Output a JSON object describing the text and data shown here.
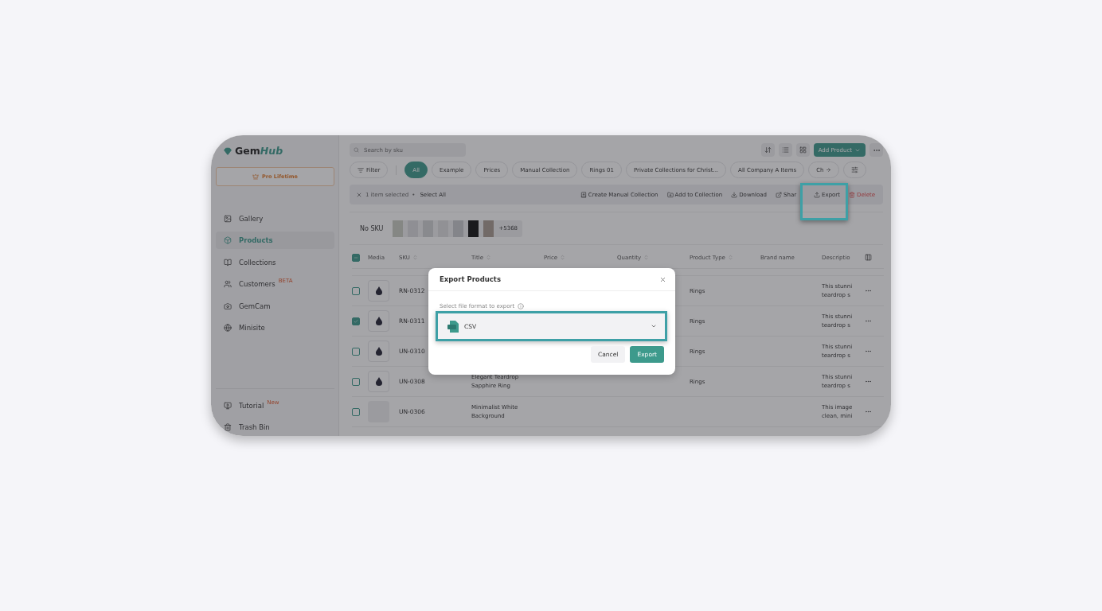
{
  "logo": {
    "text_a": "Gem",
    "text_b": "Hub"
  },
  "plan_badge": "Pro Lifetime",
  "sidebar": {
    "items": [
      {
        "label": "Gallery",
        "selected": false
      },
      {
        "label": "Products",
        "selected": true
      },
      {
        "label": "Collections",
        "selected": false
      },
      {
        "label": "Customers",
        "selected": false,
        "badge": "BETA"
      },
      {
        "label": "GemCam",
        "selected": false
      },
      {
        "label": "Minisite",
        "selected": false
      }
    ],
    "bottom_items": [
      {
        "label": "Tutorial",
        "badge": "New"
      },
      {
        "label": "Trash Bin"
      }
    ]
  },
  "search": {
    "placeholder": "Search by sku"
  },
  "add_product_button": "Add Product",
  "filter_button": "Filter",
  "chips": [
    {
      "label": "All",
      "selected": true
    },
    {
      "label": "Example",
      "selected": false
    },
    {
      "label": "Prices",
      "selected": false
    },
    {
      "label": "Manual Collection",
      "selected": false
    },
    {
      "label": "Rings 01",
      "selected": false
    },
    {
      "label": "Private Collections for Christ...",
      "selected": false
    },
    {
      "label": "All Company A Items",
      "selected": false
    },
    {
      "label": "Ch",
      "selected": false
    }
  ],
  "selection_bar": {
    "count_text": "1 item selected",
    "separator": "•",
    "select_all": "Select All",
    "actions": [
      {
        "label": "Create Manual Collection",
        "kind": "normal"
      },
      {
        "label": "Add to Collection",
        "kind": "normal"
      },
      {
        "label": "Download",
        "kind": "normal"
      },
      {
        "label": "Shar",
        "kind": "normal"
      },
      {
        "label": "Export",
        "kind": "normal"
      },
      {
        "label": "Delete",
        "kind": "danger"
      }
    ]
  },
  "sku_group": {
    "label": "No SKU",
    "more_count": "+5368"
  },
  "table": {
    "header_checkbox_indeterminate": true,
    "columns": [
      {
        "label": "Media",
        "sortable": false
      },
      {
        "label": "SKU",
        "sortable": true
      },
      {
        "label": "Title",
        "sortable": true
      },
      {
        "label": "Price",
        "sortable": true
      },
      {
        "label": "Quantity",
        "sortable": true
      },
      {
        "label": "Product Type",
        "sortable": true
      },
      {
        "label": "Brand name",
        "sortable": false
      },
      {
        "label": "Descriptio",
        "sortable": false
      }
    ],
    "rows": [
      {
        "selected": false,
        "has_image": true,
        "sku": "RN-0312",
        "product_type": "Rings",
        "description": "This stunni teardrop s"
      },
      {
        "selected": true,
        "has_image": true,
        "sku": "RN-0311",
        "product_type": "Rings",
        "description": "This stunni teardrop s"
      },
      {
        "selected": false,
        "has_image": true,
        "sku": "UN-0310",
        "product_type": "Rings",
        "description": "This stunni teardrop s"
      },
      {
        "selected": false,
        "has_image": true,
        "sku": "UN-0308",
        "title": "Elegant Teardrop Sapphire Ring",
        "product_type": "Rings",
        "description": "This stunni teardrop s"
      },
      {
        "selected": false,
        "has_image": false,
        "sku": "UN-0306",
        "title": "Minimalist White Background",
        "description": "This image clean, mini"
      }
    ]
  },
  "modal": {
    "title": "Export Products",
    "field_label": "Select file format to export",
    "format": "CSV",
    "buttons": [
      {
        "label": "Cancel",
        "kind": "secondary"
      },
      {
        "label": "Export",
        "kind": "primary"
      }
    ]
  }
}
